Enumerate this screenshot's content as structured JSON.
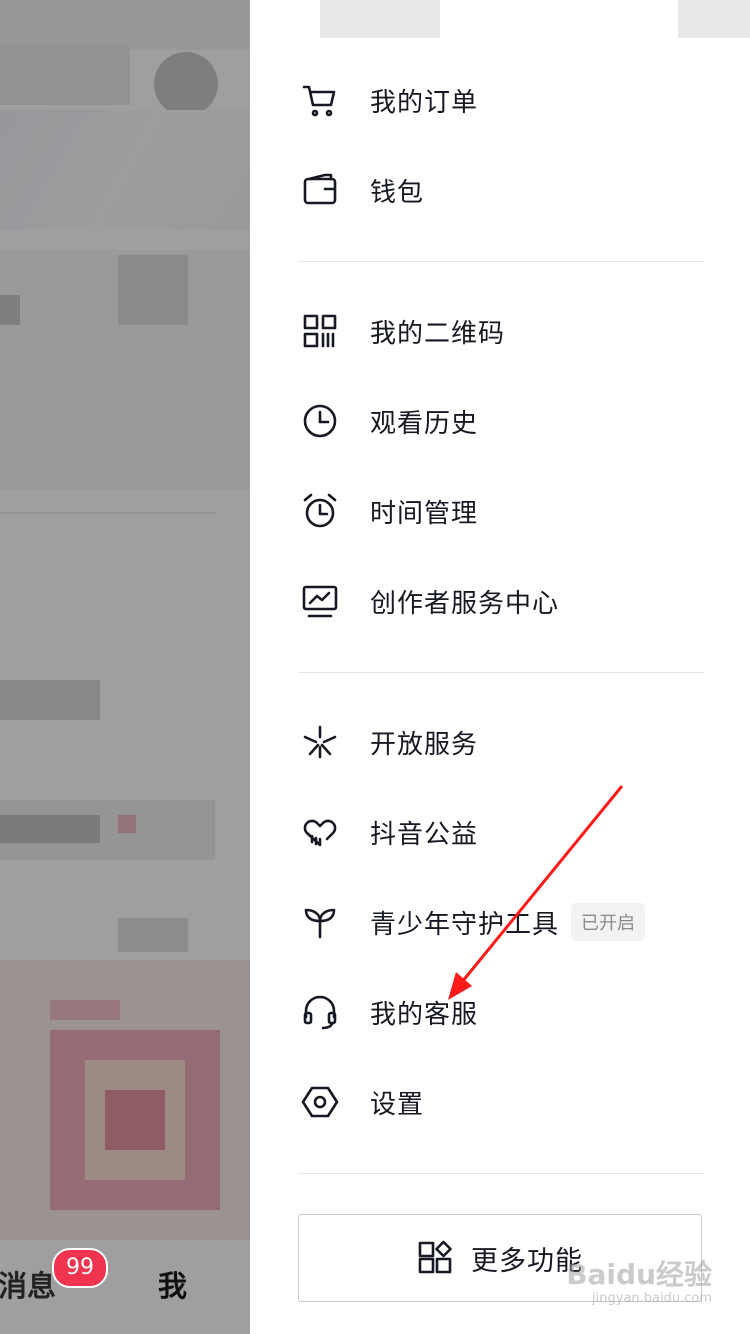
{
  "menu_groups": [
    {
      "items": [
        {
          "icon": "cart-icon",
          "label": "我的订单"
        },
        {
          "icon": "wallet-icon",
          "label": "钱包"
        }
      ]
    },
    {
      "items": [
        {
          "icon": "qrcode-icon",
          "label": "我的二维码"
        },
        {
          "icon": "clock-icon",
          "label": "观看历史"
        },
        {
          "icon": "alarm-clock-icon",
          "label": "时间管理"
        },
        {
          "icon": "chart-monitor-icon",
          "label": "创作者服务中心"
        }
      ]
    },
    {
      "items": [
        {
          "icon": "asterisk-icon",
          "label": "开放服务"
        },
        {
          "icon": "heart-hand-icon",
          "label": "抖音公益"
        },
        {
          "icon": "sprout-icon",
          "label": "青少年守护工具",
          "tag": "已开启"
        },
        {
          "icon": "headset-icon",
          "label": "我的客服"
        },
        {
          "icon": "hexagon-gear-icon",
          "label": "设置"
        }
      ]
    }
  ],
  "more_button": {
    "icon": "grid-apps-icon",
    "label": "更多功能"
  },
  "background_app": {
    "tab_messages": "消息",
    "tab_me": "我",
    "messages_badge": "99"
  },
  "watermark": {
    "brand": "Baidu经验",
    "url": "jingyan.baidu.com"
  },
  "colors": {
    "text": "#161823",
    "badge": "#f0344f",
    "arrow": "#ff1a1a",
    "divider": "#e6e6e6"
  }
}
